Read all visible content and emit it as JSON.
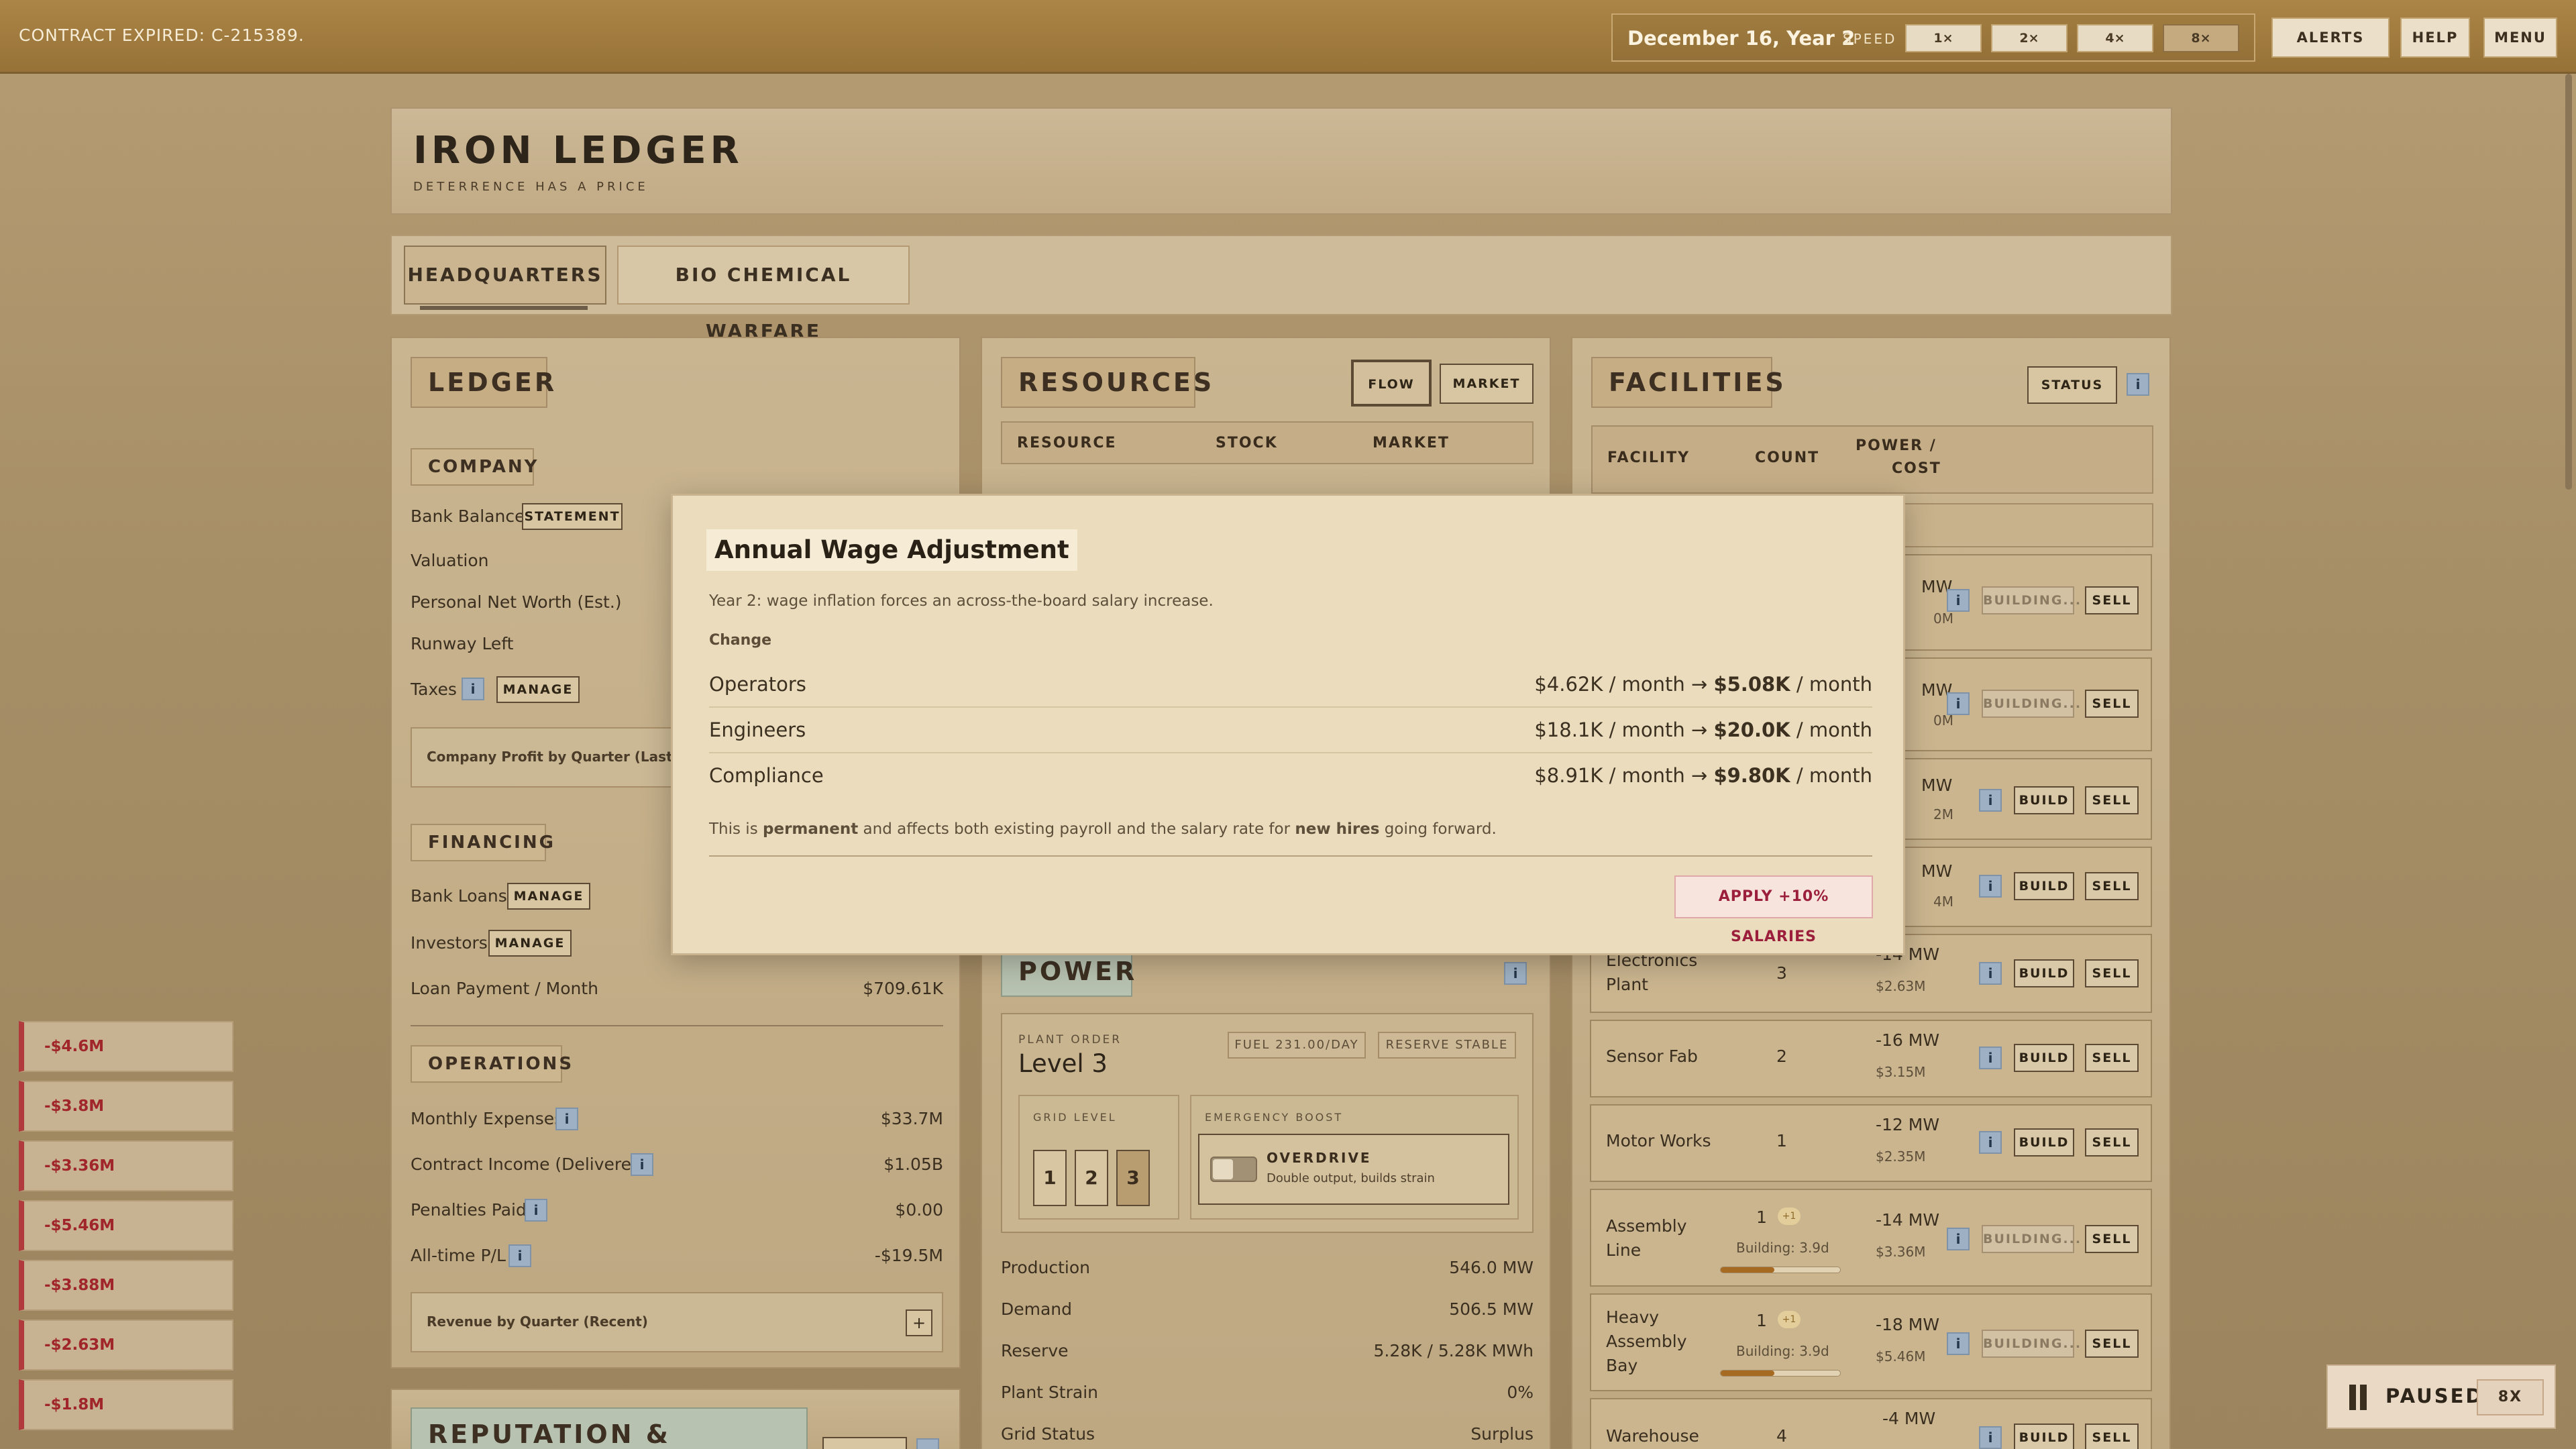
{
  "topbar": {
    "contract_notice": "CONTRACT EXPIRED: C-215389.",
    "date": "December 16, Year 2",
    "speed_label": "SPEED",
    "speeds": [
      "1×",
      "2×",
      "4×",
      "8×"
    ],
    "alerts": "ALERTS",
    "help": "HELP",
    "menu": "MENU"
  },
  "header": {
    "title": "IRON LEDGER",
    "subtitle": "DETERRENCE HAS A PRICE"
  },
  "tabs": [
    "HEADQUARTERS",
    "BIO CHEMICAL WARFARE"
  ],
  "ledger": {
    "title": "LEDGER",
    "company_title": "COMPANY",
    "bank_balance": "Bank Balance",
    "statement": "STATEMENT",
    "valuation": "Valuation",
    "net_worth": "Personal Net Worth (Est.)",
    "runway": "Runway Left",
    "taxes": "Taxes",
    "manage": "MANAGE",
    "profit_chart": "Company Profit by Quarter (Last 6 Qu",
    "financing_title": "FINANCING",
    "bank_loans": "Bank Loans",
    "investors": "Investors",
    "loan_payment": "Loan Payment / Month",
    "loan_payment_val": "$709.61K",
    "operations_title": "OPERATIONS",
    "monthly_expenses": "Monthly Expenses",
    "monthly_expenses_val": "$33.7M",
    "contract_income": "Contract Income (Delivered)",
    "contract_income_val": "$1.05B",
    "penalties": "Penalties Paid",
    "penalties_val": "$0.00",
    "alltime": "All-time P/L",
    "alltime_val": "-$19.5M",
    "revenue_chart": "Revenue by Quarter (Recent)",
    "plus": "+",
    "reputation_title": "REPUTATION &"
  },
  "resources": {
    "title": "RESOURCES",
    "flow": "FLOW",
    "market": "MARKET",
    "col_resource": "RESOURCE",
    "col_stock": "STOCK",
    "col_market": "MARKET"
  },
  "power": {
    "title": "POWER",
    "plant_order": "PLANT ORDER",
    "level": "Level 3",
    "fuel": "FUEL 231.00/DAY",
    "reserve_stable": "RESERVE STABLE",
    "grid_level": "GRID LEVEL",
    "grid_levels": [
      "1",
      "2",
      "3"
    ],
    "emergency_boost": "EMERGENCY BOOST",
    "overdrive": "OVERDRIVE",
    "overdrive_desc": "Double output, builds strain",
    "stats": [
      {
        "label": "Production",
        "value": "546.0 MW"
      },
      {
        "label": "Demand",
        "value": "506.5 MW"
      },
      {
        "label": "Reserve",
        "value": "5.28K / 5.28K MWh"
      },
      {
        "label": "Plant Strain",
        "value": "0%"
      },
      {
        "label": "Grid Status",
        "value": "Surplus"
      }
    ]
  },
  "facilities": {
    "title": "FACILITIES",
    "status": "STATUS",
    "col_facility": "FACILITY",
    "col_count": "COUNT",
    "col_power": "POWER /",
    "col_cost": "COST",
    "build": "BUILD",
    "building": "BUILDING...",
    "sell": "SELL",
    "partial_rows": [
      {
        "power": "MW",
        "cost": "0M"
      },
      {
        "power": "MW",
        "cost": "0M"
      },
      {
        "power": "MW",
        "cost": "2M"
      },
      {
        "power": "MW",
        "cost": "4M"
      }
    ],
    "rows": [
      {
        "name": "Electronics Plant",
        "count": "3",
        "power": "-14 MW",
        "cost": "$2.63M"
      },
      {
        "name": "Sensor Fab",
        "count": "2",
        "power": "-16 MW",
        "cost": "$3.15M"
      },
      {
        "name": "Motor Works",
        "count": "1",
        "power": "-12 MW",
        "cost": "$2.35M"
      },
      {
        "name": "Assembly Line",
        "count": "1",
        "extra": "+1",
        "building": "Building: 3.9d",
        "progress": 0.45,
        "power": "-14 MW",
        "cost": "$3.36M"
      },
      {
        "name": "Heavy Assembly Bay",
        "count": "1",
        "extra": "+1",
        "building": "Building: 3.9d",
        "progress": 0.45,
        "power": "-18 MW",
        "cost": "$5.46M"
      },
      {
        "name": "Warehouse",
        "count": "4",
        "power": "-4 MW",
        "cost": ""
      }
    ]
  },
  "notifications": [
    "-$4.6M",
    "-$3.8M",
    "-$3.36M",
    "-$5.46M",
    "-$3.88M",
    "-$2.63M",
    "-$1.8M"
  ],
  "modal": {
    "title": "Annual Wage Adjustment",
    "description": "Year 2: wage inflation forces an across-the-board salary increase.",
    "change_label": "Change",
    "rows": [
      {
        "role": "Operators",
        "from": "$4.62K / month →",
        "to": "$5.08K",
        "unit": "/ month"
      },
      {
        "role": "Engineers",
        "from": "$18.1K / month →",
        "to": "$20.0K",
        "unit": "/ month"
      },
      {
        "role": "Compliance",
        "from": "$8.91K / month →",
        "to": "$9.80K",
        "unit": "/ month"
      }
    ],
    "foot_1": "This is ",
    "foot_bold1": "permanent",
    "foot_2": " and affects both existing payroll and the salary rate for ",
    "foot_bold2": "new hires",
    "foot_3": " going forward.",
    "apply": "APPLY +10% SALARIES"
  },
  "status": {
    "paused": "PAUSED",
    "speed": "8X"
  }
}
